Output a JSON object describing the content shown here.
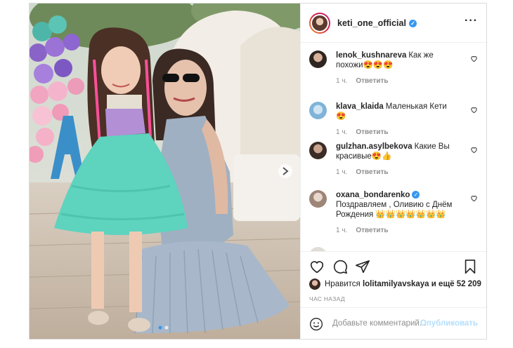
{
  "post": {
    "owner": "keti_one_official",
    "more_icon": "more-horizontal-icon"
  },
  "comments": [
    {
      "user": "lenok_kushnareva",
      "text": "Как же похожи😍😍😍",
      "time": "1 ч.",
      "reply": "Ответить"
    },
    {
      "user": "klava_klaida",
      "text": "Маленькая Кети😍",
      "time": "1 ч.",
      "reply": "Ответить"
    },
    {
      "user": "gulzhan.asylbekova",
      "text": "Какие Вы красивые😍👍",
      "time": "1 ч.",
      "reply": "Ответить"
    },
    {
      "user": "oxana_bondarenko",
      "text": "Поздравляем , Оливию с Днём Рождения 👑👑👑👑👑👑👑",
      "time": "1 ч.",
      "reply": "Ответить"
    }
  ],
  "likes": {
    "prefix": "Нравится",
    "user": "lolitamilyavskaya",
    "and_more": "и ещё 52 209"
  },
  "time_ago": "ЧАС НАЗАД",
  "add_comment": {
    "placeholder": "Добавьте комментарий...",
    "publish": "Опубликовать"
  },
  "colors": {
    "accent": "#3897f0",
    "publish_disabled": "#b2dffc",
    "border": "#dbdbdb"
  }
}
